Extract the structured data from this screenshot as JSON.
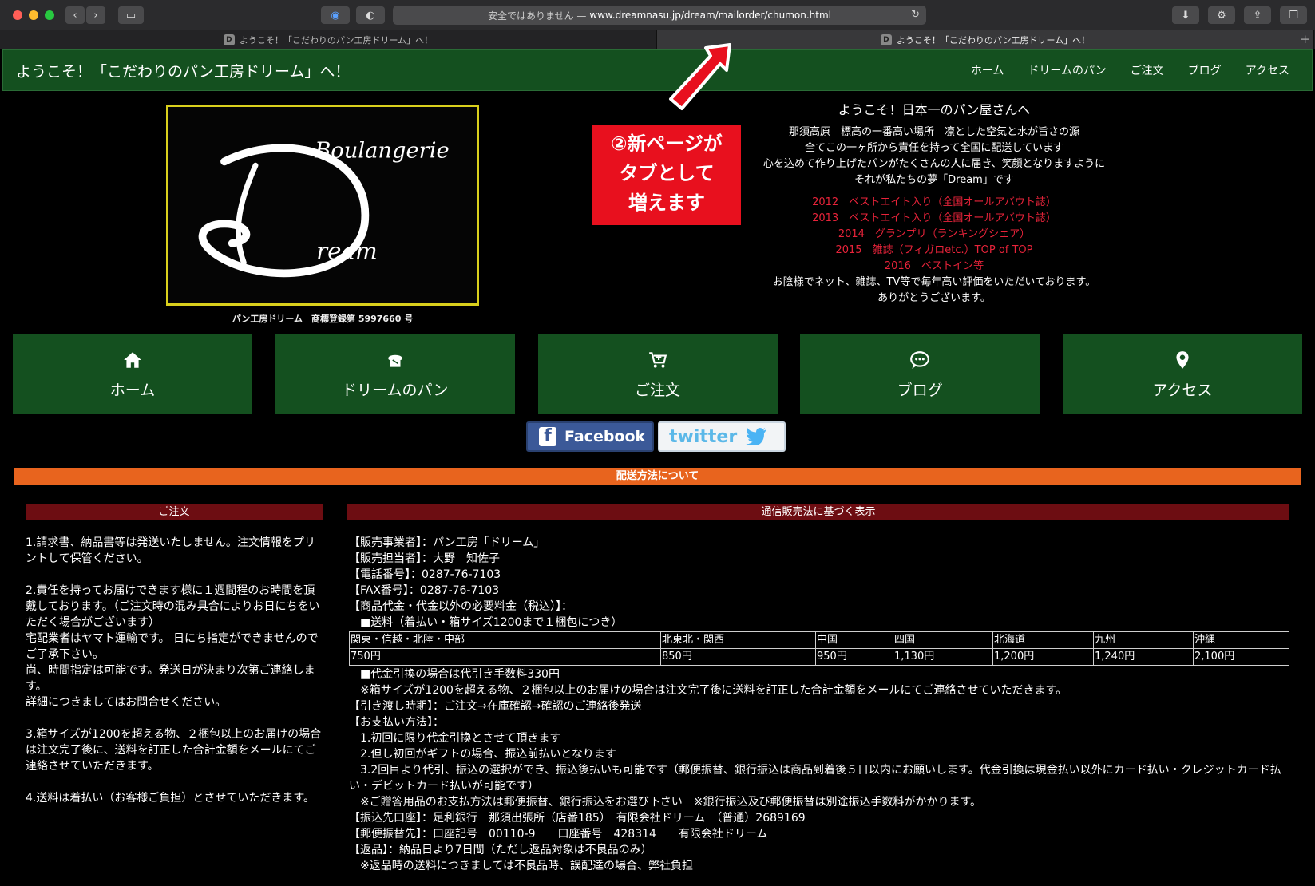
{
  "browser": {
    "address_prefix": "安全ではありません —",
    "url": "www.dreamnasu.jp/dream/mailorder/chumon.html",
    "tabs": [
      {
        "favicon": "D",
        "title": "ようこそ！「こだわりのパン工房ドリーム」へ！"
      },
      {
        "favicon": "D",
        "title": "ようこそ！「こだわりのパン工房ドリーム」へ！"
      }
    ]
  },
  "header": {
    "title": "ようこそ！「こだわりのパン工房ドリーム」へ！",
    "nav": [
      "ホーム",
      "ドリームのパン",
      "ご注文",
      "ブログ",
      "アクセス"
    ]
  },
  "logo": {
    "text_top": "Boulangerie",
    "text_bottom": "ream",
    "letter": "D"
  },
  "trademark": "パン工房ドリーム　商標登録第 5997660 号",
  "annotation": {
    "line1": "②新ページが",
    "line2": "タブとして",
    "line3": "増えます"
  },
  "welcome": {
    "heading": "ようこそ！日本一のパン屋さんへ",
    "lines": [
      "那須高原　標高の一番高い場所　凛とした空気と水が旨さの源",
      "全てこの一ヶ所から責任を持って全国に配送しています",
      "心を込めて作り上げたパンがたくさんの人に届き、笑顔となりますように",
      "それが私たちの夢「Dream」です"
    ],
    "awards": [
      "2012　ベストエイト入り（全国オールアバウト誌）",
      "2013　ベストエイト入り（全国オールアバウト誌）",
      "2014　グランプリ（ランキングシェア）",
      "2015　雑誌（フィガロetc.）TOP of TOP",
      "2016　ベストイン等"
    ],
    "closing": [
      "お陰様でネット、雑誌、TV等で毎年高い評価をいただいております。",
      "ありがとうございます。"
    ]
  },
  "bignav": [
    {
      "label": "ホーム",
      "icon": "home-icon"
    },
    {
      "label": "ドリームのパン",
      "icon": "bread-icon"
    },
    {
      "label": "ご注文",
      "icon": "cart-icon"
    },
    {
      "label": "ブログ",
      "icon": "chat-icon"
    },
    {
      "label": "アクセス",
      "icon": "map-pin-icon"
    }
  ],
  "social": {
    "facebook": "Facebook",
    "twitter": "twitter"
  },
  "shipping_bar": "配送方法について",
  "order": {
    "heading": "ご注文",
    "paragraphs": [
      "1.請求書、納品書等は発送いたしません。注文情報をプリントして保管ください。",
      "2.責任を持ってお届けできます様に１週間程のお時間を頂戴しております。（ご注文時の混み具合によりお日にちをいただく場合がございます）\n宅配業者はヤマト運輸です。 日にち指定ができませんのでご了承下さい。\n尚、時間指定は可能です。発送日が決まり次第ご連絡します。\n詳細につきましてはお問合せください。",
      "3.箱サイズが1200を超える物、２梱包以上のお届けの場合は注文完了後に、送料を訂正した合計金額をメールにてご連絡させていただきます。",
      "4.送料は着払い（お客様ご負担）とさせていただきます。"
    ]
  },
  "law": {
    "heading": "通信販売法に基づく表示",
    "lines_before": [
      "【販売事業者】：パン工房「ドリーム」",
      "【販売担当者】：大野　知佐子",
      "【電話番号】：0287-76-7103",
      "【FAX番号】：0287-76-7103",
      "【商品代金・代金以外の必要料金（税込）】：",
      "　■送料（着払い・箱サイズ1200まで１梱包につき）"
    ],
    "table": {
      "headers": [
        "関東・信越・北陸・中部",
        "北東北・関西",
        "中国",
        "四国",
        "北海道",
        "九州",
        "沖縄"
      ],
      "values": [
        "750円",
        "850円",
        "950円",
        "1,130円",
        "1,200円",
        "1,240円",
        "2,100円"
      ]
    },
    "lines_after": [
      "　■代金引換の場合は代引き手数料330円",
      "　※箱サイズが1200を超える物、２梱包以上のお届けの場合は注文完了後に送料を訂正した合計金額をメールにてご連絡させていただきます。",
      "【引き渡し時期】：ご注文→在庫確認→確認のご連絡後発送",
      "【お支払い方法】：",
      "　1.初回に限り代金引換とさせて頂きます",
      "　2.但し初回がギフトの場合、振込前払いとなります",
      "　3.2回目より代引、振込の選択ができ、振込後払いも可能です（郵便振替、銀行振込は商品到着後５日以内にお願いします。代金引換は現金払い以外にカード払い・クレジットカード払い・デビットカード払いが可能です）",
      "　※ご贈答用品のお支払方法は郵便振替、銀行振込をお選び下さい　※銀行振込及び郵便振替は別途振込手数料がかかります。",
      "【振込先口座】：足利銀行　那須出張所（店番185）　有限会社ドリーム　（普通）2689169",
      "【郵便振替先】：口座記号　00110-9　　口座番号　428314　　有限会社ドリーム",
      "【返品】：納品日より7日間（ただし返品対象は不良品のみ）",
      "　※返品時の送料につきましては不良品時、誤配達の場合、弊社負担"
    ]
  }
}
